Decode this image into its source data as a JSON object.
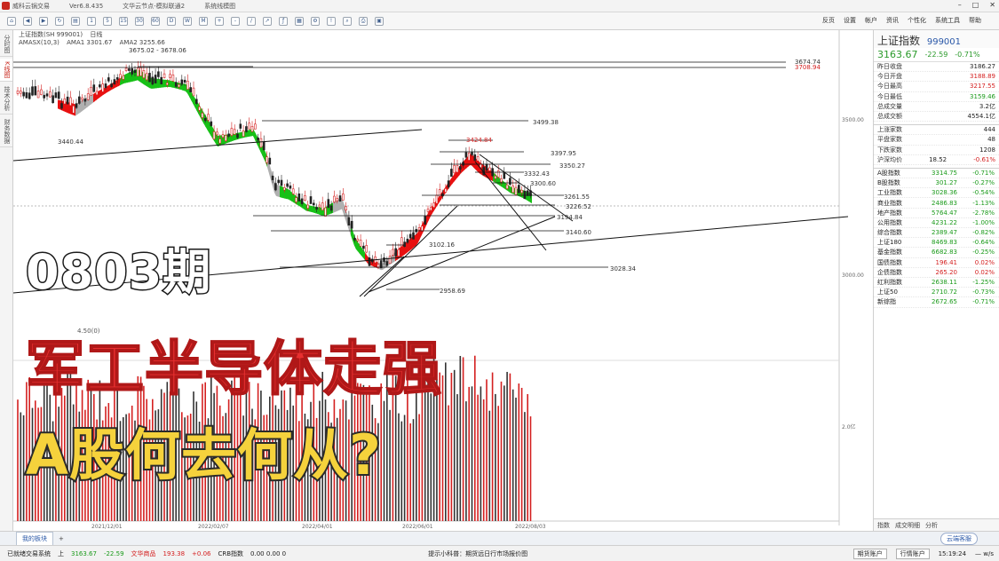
{
  "title_bar": {
    "app_name": "威科云锅交易",
    "version": "Ver6.8.435",
    "doc_title": "文华云节点-模拟联通2",
    "tab": "系统线模图"
  },
  "toolbar": {
    "menu": [
      "反页",
      "设置",
      "帐户",
      "资讯",
      "个性化",
      "系统工具",
      "帮助"
    ]
  },
  "left_tabs": [
    "分时图",
    "K线图",
    "技术分析",
    "财务数据"
  ],
  "chart": {
    "header_symbol": "上证指数(SH 999001)",
    "period": "日线",
    "indicator": "AMASX(10,3)",
    "ama1": "AMA1 3301.67",
    "ama2": "AMA2 3255.66",
    "labels": [
      {
        "text": "3708.94",
        "color": "#d42020"
      },
      {
        "text": "3675.02 - 3678.06",
        "color": "#333"
      },
      {
        "text": "3674.74",
        "color": "#333"
      },
      {
        "text": "3499.38",
        "color": "#333"
      },
      {
        "text": "3440.44",
        "color": "#333"
      },
      {
        "text": "3424.84",
        "color": "#d42020"
      },
      {
        "text": "3397.95",
        "color": "#333"
      },
      {
        "text": "3350.27",
        "color": "#333"
      },
      {
        "text": "3332.43",
        "color": "#333"
      },
      {
        "text": "3300.60",
        "color": "#333"
      },
      {
        "text": "3261.55",
        "color": "#333"
      },
      {
        "text": "3226.52",
        "color": "#333"
      },
      {
        "text": "3194.84",
        "color": "#333"
      },
      {
        "text": "3140.60",
        "color": "#333"
      },
      {
        "text": "3102.16",
        "color": "#333"
      },
      {
        "text": "3028.34",
        "color": "#333"
      },
      {
        "text": "2958.69",
        "color": "#333"
      }
    ],
    "price_axis": [
      "3500.00",
      "3000.00"
    ],
    "volume_axis": "2.0亿",
    "volume_label": "4.50(0)",
    "date_labels": [
      "2021/12/01",
      "2022/02/07",
      "2022/04/01",
      "2022/06/01",
      "2022/08/03"
    ]
  },
  "overlay": {
    "line1": "0803期",
    "line2": "军工半导体走强",
    "line3": "A股何去何从?"
  },
  "quote_panel": {
    "name": "上证指数",
    "code": "999001",
    "price": "3163.67",
    "change": "-22.59",
    "change_pct": "-0.71%",
    "stats": [
      {
        "label": "昨日收盘",
        "value": "3186.27",
        "tone": "normal"
      },
      {
        "label": "今日开盘",
        "value": "3188.89",
        "tone": "red"
      },
      {
        "label": "今日最高",
        "value": "3217.55",
        "tone": "red"
      },
      {
        "label": "今日最低",
        "value": "3159.46",
        "tone": "green"
      },
      {
        "label": "总成交量",
        "value": "3.2亿",
        "tone": "normal"
      },
      {
        "label": "总成交额",
        "value": "4554.1亿",
        "tone": "normal"
      }
    ],
    "breadth": [
      {
        "label": "上涨家数",
        "value": "444",
        "tone": "normal"
      },
      {
        "label": "平盘家数",
        "value": "48",
        "tone": "normal"
      },
      {
        "label": "下跌家数",
        "value": "1208",
        "tone": "normal"
      }
    ],
    "hk_flow": {
      "label": "沪深均价",
      "value": "18.52",
      "pct": "-0.61%"
    },
    "indices": [
      {
        "name": "A股指数",
        "price": "3314.75",
        "pct": "-0.71%"
      },
      {
        "name": "B股指数",
        "price": "301.27",
        "pct": "-0.27%"
      },
      {
        "name": "工业指数",
        "price": "3028.36",
        "pct": "-0.54%"
      },
      {
        "name": "商业指数",
        "price": "2486.83",
        "pct": "-1.13%"
      },
      {
        "name": "地产指数",
        "price": "5764.47",
        "pct": "-2.78%"
      },
      {
        "name": "公用指数",
        "price": "4231.22",
        "pct": "-1.00%"
      },
      {
        "name": "综合指数",
        "price": "2389.47",
        "pct": "-0.82%"
      },
      {
        "name": "上证180",
        "price": "8469.83",
        "pct": "-0.64%"
      },
      {
        "name": "基金指数",
        "price": "6682.83",
        "pct": "-0.25%"
      },
      {
        "name": "国债指数",
        "price": "196.41",
        "pct": "0.02%"
      },
      {
        "name": "企债指数",
        "price": "265.20",
        "pct": "0.02%"
      },
      {
        "name": "红利指数",
        "price": "2638.11",
        "pct": "-1.25%"
      },
      {
        "name": "上证50",
        "price": "2710.72",
        "pct": "-0.73%"
      },
      {
        "name": "新综指",
        "price": "2672.65",
        "pct": "-0.71%"
      }
    ],
    "bottom_tabs": [
      "指数",
      "成交明细",
      "分析"
    ]
  },
  "bottom_tabbar": {
    "active_tab": "我的板块",
    "right_button": "云端客服"
  },
  "status_bar": {
    "left_text": "已就绪交易系统",
    "sh_label": "上",
    "sh_price": "3163.67",
    "sh_change": "-22.59",
    "wh_label": "文华商品",
    "wh_price": "193.38",
    "wh_change": "+0.06",
    "crb_label": "CRB指数",
    "crb_values": "0.00  0.00  0",
    "notice": "提示小科普：期货远日行市场报价图",
    "btn1": "期货账户",
    "btn2": "行情账户",
    "clock": "15:19:24",
    "speed": "— w/s"
  },
  "colors": {
    "up": "#d42020",
    "down": "#1a9a1a",
    "band_green": "#17c017",
    "band_red": "#e81010"
  }
}
